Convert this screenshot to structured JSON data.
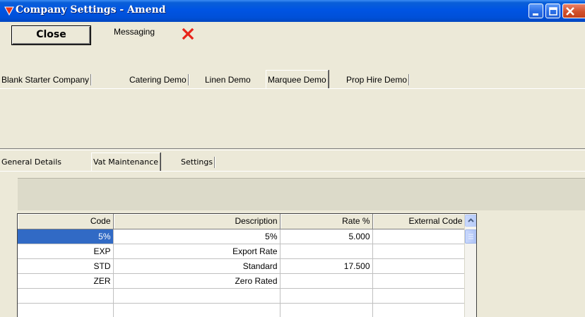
{
  "window": {
    "title": "Company Settings - Amend"
  },
  "toolbar": {
    "close_label": "Close",
    "messaging_label": "Messaging"
  },
  "company_tabs": [
    {
      "label": "Blank Starter Company"
    },
    {
      "label": "Catering Demo"
    },
    {
      "label": "Linen Demo"
    },
    {
      "label": "Marquee Demo"
    },
    {
      "label": "Prop Hire Demo"
    }
  ],
  "active_company_tab": "Marquee Demo",
  "detail_tabs": [
    {
      "label": "General Details"
    },
    {
      "label": "Vat Maintenance"
    },
    {
      "label": "Settings"
    }
  ],
  "active_detail_tab": "Vat Maintenance",
  "vat_grid": {
    "columns": [
      "Code",
      "Description",
      "Rate %",
      "External Code"
    ],
    "rows": [
      {
        "code": "5%",
        "description": "5%",
        "rate": "5.000",
        "external": ""
      },
      {
        "code": "EXP",
        "description": "Export Rate",
        "rate": "",
        "external": ""
      },
      {
        "code": "STD",
        "description": "Standard",
        "rate": "17.500",
        "external": ""
      },
      {
        "code": "ZER",
        "description": "Zero Rated",
        "rate": "",
        "external": ""
      },
      {
        "code": "",
        "description": "",
        "rate": "",
        "external": ""
      },
      {
        "code": "",
        "description": "",
        "rate": "",
        "external": ""
      }
    ],
    "selected_row": 0
  },
  "colors": {
    "titlebar": "#0054e3",
    "selection": "#316ac5",
    "delete_icon": "#e8241a",
    "window_face": "#ece9d8"
  }
}
